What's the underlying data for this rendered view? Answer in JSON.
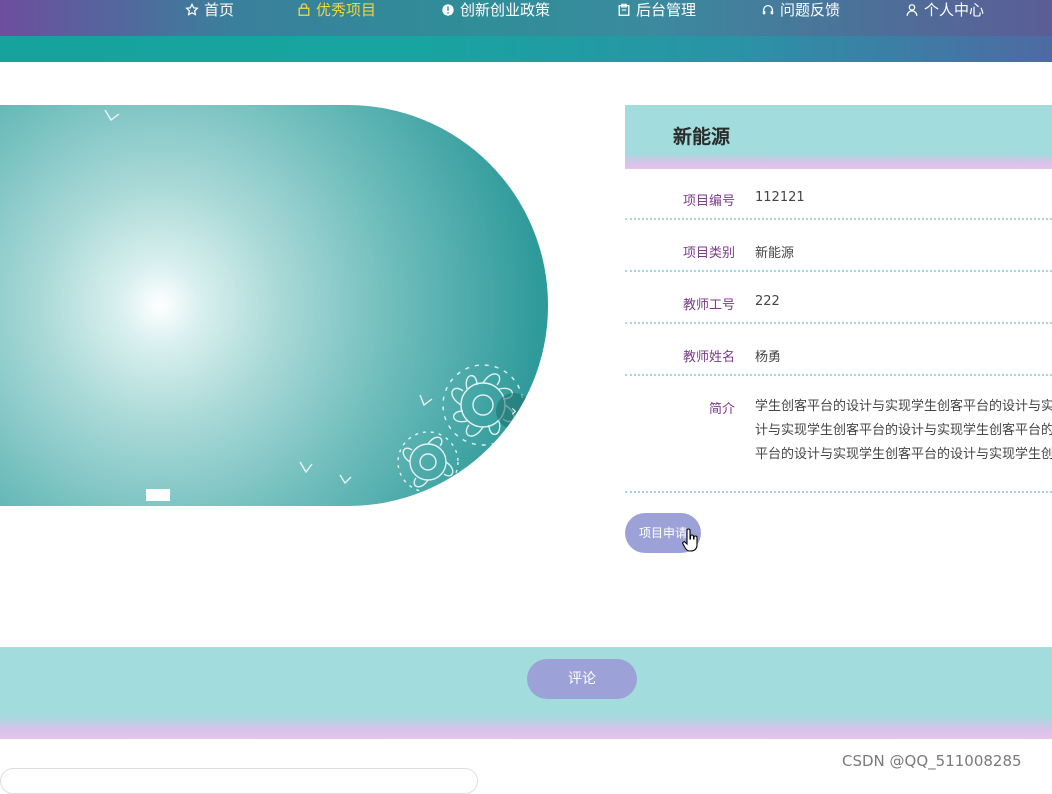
{
  "nav": {
    "items": [
      {
        "label": "首页",
        "icon": "star-icon",
        "active": false
      },
      {
        "label": "优秀项目",
        "icon": "bag-icon",
        "active": true
      },
      {
        "label": "创新创业政策",
        "icon": "info-circle-icon",
        "active": false
      },
      {
        "label": "后台管理",
        "icon": "clipboard-icon",
        "active": false
      },
      {
        "label": "问题反馈",
        "icon": "headset-icon",
        "active": false
      },
      {
        "label": "个人中心",
        "icon": "user-icon",
        "active": false
      }
    ],
    "active_color": "#f4d53a"
  },
  "carousel": {
    "next_symbol": "›"
  },
  "project": {
    "title": "新能源",
    "fields": [
      {
        "label": "项目编号",
        "value": "112121"
      },
      {
        "label": "项目类别",
        "value": "新能源"
      },
      {
        "label": "教师工号",
        "value": "222"
      },
      {
        "label": "教师姓名",
        "value": "杨勇"
      },
      {
        "label": "简介",
        "value": "学生创客平台的设计与实现学生创客平台的设计与实现学生创客平台的设计与实现学生创客平台的设计与实现学生创客平台的设计与实现学生创客平台的设计与实现学生创客平台的设计与实现学生创客平台的设计与实现"
      }
    ]
  },
  "actions": {
    "apply_label": "项目申请",
    "comment_label": "评论"
  },
  "watermark": "CSDN @QQ_511008285"
}
